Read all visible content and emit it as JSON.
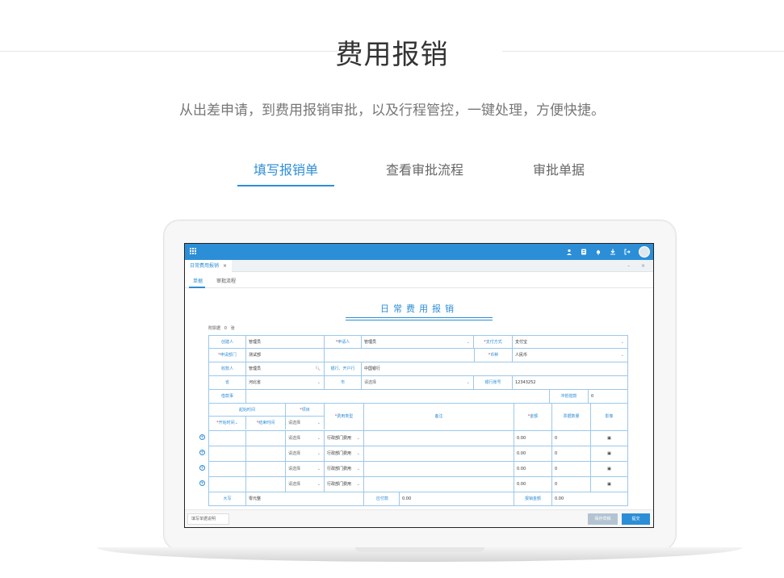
{
  "hero": {
    "title": "费用报销",
    "subtitle": "从出差申请，到费用报销审批，以及行程管控，一键处理，方便快捷。",
    "tabs": [
      "填写报销单",
      "查看审批流程",
      "审批单据"
    ]
  },
  "app": {
    "doc_tab": "日常费用报销",
    "doc_tab_close": "×",
    "window_controls": "– ×",
    "subtabs": [
      "单据",
      "审批流程"
    ],
    "form_title": "日常费用报销",
    "attachments_label": "附票据",
    "attachments_count": "0",
    "attachments_unit": "张",
    "fields": {
      "creator_label": "创建人",
      "creator_value": "管理员",
      "applicant_label": "申请人",
      "applicant_value": "管理员",
      "payment_label": "支付方式",
      "payment_value": "支付宝",
      "dept_label": "申请部门",
      "dept_value": "测试部",
      "currency_label": "币种",
      "currency_value": "人民币",
      "payee_label": "收款人",
      "payee_value": "管理员",
      "bank_label": "银行、开户行",
      "bank_value": "中国银行",
      "province_label": "省",
      "province_value": "河北省",
      "city_label": "市",
      "city_value": "请选择",
      "account_label": "银行账号",
      "account_value": "12343252",
      "reason_label": "借款事",
      "offset_label": "冲抵借款",
      "offset_value": "0"
    },
    "table_headers": {
      "time_range": "起始时间",
      "project": "项目",
      "start_time": "开始时间",
      "end_time": "结束时间",
      "expense_type": "费用类型",
      "remark": "备注",
      "amount": "金额",
      "receipt_count": "票据数量",
      "image": "影像"
    },
    "rows": [
      {
        "project": "请选择",
        "type": "行政部门费用",
        "amount": "0.00",
        "count": "0"
      },
      {
        "project": "请选择",
        "type": "行政部门费用",
        "amount": "0.00",
        "count": "0"
      },
      {
        "project": "请选择",
        "type": "行政部门费用",
        "amount": "0.00",
        "count": "0"
      },
      {
        "project": "请选择",
        "type": "行政部门费用",
        "amount": "0.00",
        "count": "0"
      }
    ],
    "totals": {
      "uppercase_label": "大写",
      "uppercase_value": "零元整",
      "payable_label": "应付款",
      "payable_value": "0.00",
      "reimb_label": "报销金额",
      "reimb_value": "0.00"
    },
    "footer": {
      "input_placeholder": "填写单据说明",
      "save_label": "保存草稿",
      "submit_label": "提交"
    }
  },
  "colors": {
    "accent": "#2e8ed8",
    "topbar": "#2c8ed6"
  }
}
